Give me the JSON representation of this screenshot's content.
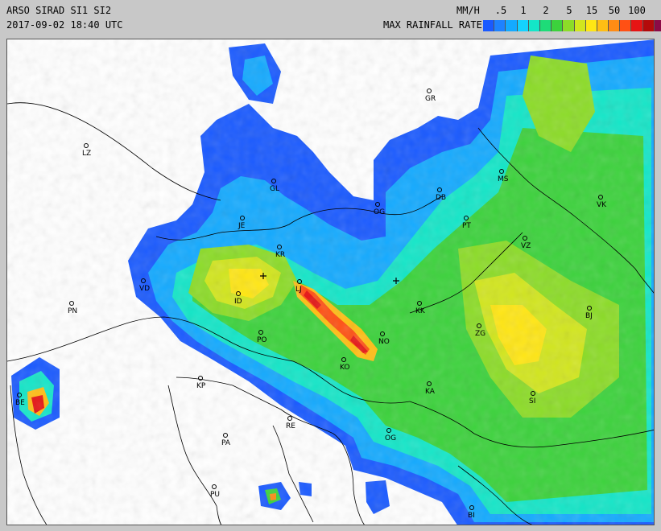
{
  "header": {
    "title": "ARSO SIRAD SI1 SI2",
    "timestamp": "2017-09-02 18:40 UTC",
    "units": "MM/H",
    "legend_title": "MAX RAINFALL RATE",
    "scale_labels": [
      ".5",
      "1",
      "2",
      "5",
      "15",
      "50",
      "100"
    ]
  },
  "legend_colors": [
    "#1a5aff",
    "#1e82ff",
    "#14aaff",
    "#14d2ff",
    "#14e6c8",
    "#1edc78",
    "#3cd23c",
    "#8cdc28",
    "#d2e61e",
    "#ffe614",
    "#ffbe14",
    "#ff8c14",
    "#ff5014",
    "#e61414",
    "#b40a0a",
    "#8c0a46",
    "#c814c8"
  ],
  "cities": [
    {
      "code": "GR"
    },
    {
      "code": "LZ"
    },
    {
      "code": "MS"
    },
    {
      "code": "OG"
    },
    {
      "code": "DB"
    },
    {
      "code": "VK"
    },
    {
      "code": "GL"
    },
    {
      "code": "JE"
    },
    {
      "code": "PT"
    },
    {
      "code": "KR"
    },
    {
      "code": "VZ"
    },
    {
      "code": "VD"
    },
    {
      "code": "LJ"
    },
    {
      "code": "PN"
    },
    {
      "code": "ID"
    },
    {
      "code": "KK"
    },
    {
      "code": "NO"
    },
    {
      "code": "BJ"
    },
    {
      "code": "ZG"
    },
    {
      "code": "PO"
    },
    {
      "code": "KO"
    },
    {
      "code": "KP"
    },
    {
      "code": "KA"
    },
    {
      "code": "SI"
    },
    {
      "code": "BE"
    },
    {
      "code": "RE"
    },
    {
      "code": "PA"
    },
    {
      "code": "OG"
    },
    {
      "code": "PU"
    },
    {
      "code": "BI"
    }
  ]
}
